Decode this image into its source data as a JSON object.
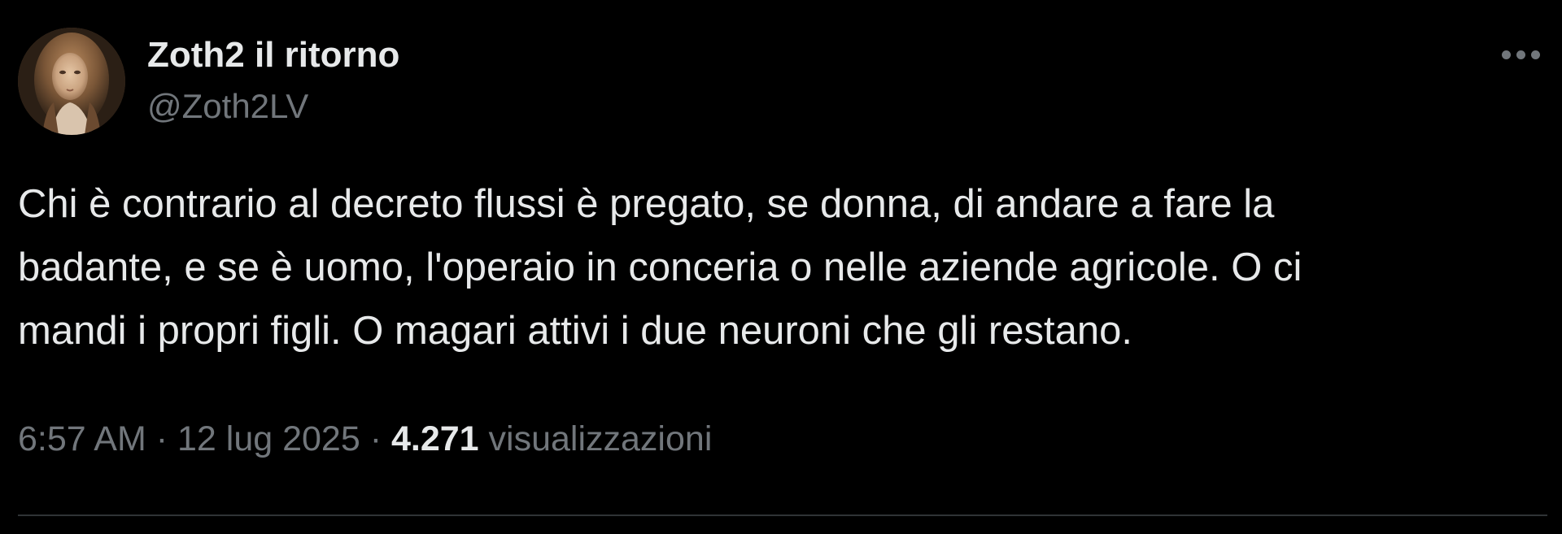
{
  "author": {
    "display_name": "Zoth2 il ritorno",
    "handle": "@Zoth2LV",
    "avatar_icon": "portrait-avatar"
  },
  "more_icon": "more-horizontal-icon",
  "tweet": {
    "text": "Chi è contrario al decreto flussi è pregato, se donna, di andare a fare la\nbadante, e se è uomo, l'operaio in conceria o nelle aziende agricole. O ci\nmandi i propri figli. O magari attivi i due neuroni che gli restano."
  },
  "meta": {
    "time": "6:57 AM",
    "separator": " · ",
    "date": "12 lug 2025",
    "views_count": "4.271",
    "views_label": "visualizzazioni"
  },
  "colors": {
    "background": "#000000",
    "primary_text": "#e7e9ea",
    "secondary_text": "#71767b",
    "divider": "#2f3336"
  }
}
